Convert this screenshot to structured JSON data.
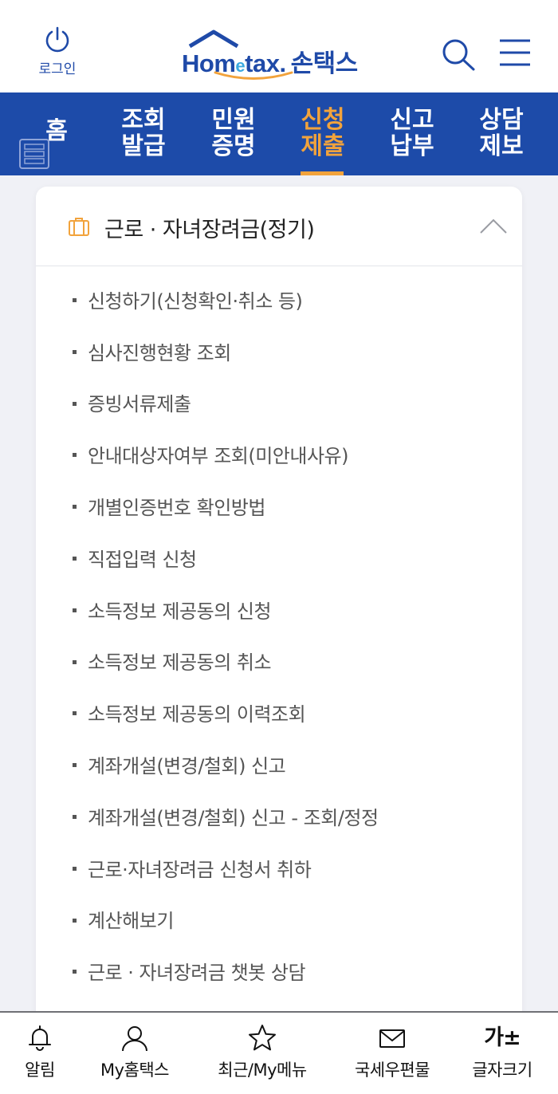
{
  "header": {
    "login_label": "로그인",
    "logo": {
      "latin_pre": "Hom",
      "latin_e": "e",
      "latin_post": "tax.",
      "korean": "손택스"
    }
  },
  "nav": {
    "home": "홈",
    "items": [
      {
        "line1": "조회",
        "line2": "발급",
        "active": false
      },
      {
        "line1": "민원",
        "line2": "증명",
        "active": false
      },
      {
        "line1": "신청",
        "line2": "제출",
        "active": true
      },
      {
        "line1": "신고",
        "line2": "납부",
        "active": false
      },
      {
        "line1": "상담",
        "line2": "제보",
        "active": false
      }
    ],
    "bg_color": "#1d4ba9",
    "active_color": "#f2a33c"
  },
  "section": {
    "title": "근로 · 자녀장려금(정기)",
    "expanded": true,
    "icon": "briefcase-icon",
    "items": [
      "신청하기(신청확인·취소 등)",
      "심사진행현황 조회",
      "증빙서류제출",
      "안내대상자여부 조회(미안내사유)",
      "개별인증번호 확인방법",
      "직접입력 신청",
      "소득정보 제공동의 신청",
      "소득정보 제공동의 취소",
      "소득정보 제공동의 이력조회",
      "계좌개설(변경/철회) 신고",
      "계좌개설(변경/철회) 신고 - 조회/정정",
      "근로·자녀장려금 신청서 취하",
      "계산해보기",
      "근로 · 자녀장려금 챗봇 상담"
    ]
  },
  "tabbar": {
    "items": [
      {
        "label": "알림",
        "icon": "bell-icon"
      },
      {
        "label": "My홈택스",
        "icon": "person-icon"
      },
      {
        "label": "최근/My메뉴",
        "icon": "star-icon"
      },
      {
        "label": "국세우편물",
        "icon": "mail-icon"
      },
      {
        "label": "글자크기",
        "glyph": "가±",
        "icon": "font-size-icon"
      }
    ]
  }
}
